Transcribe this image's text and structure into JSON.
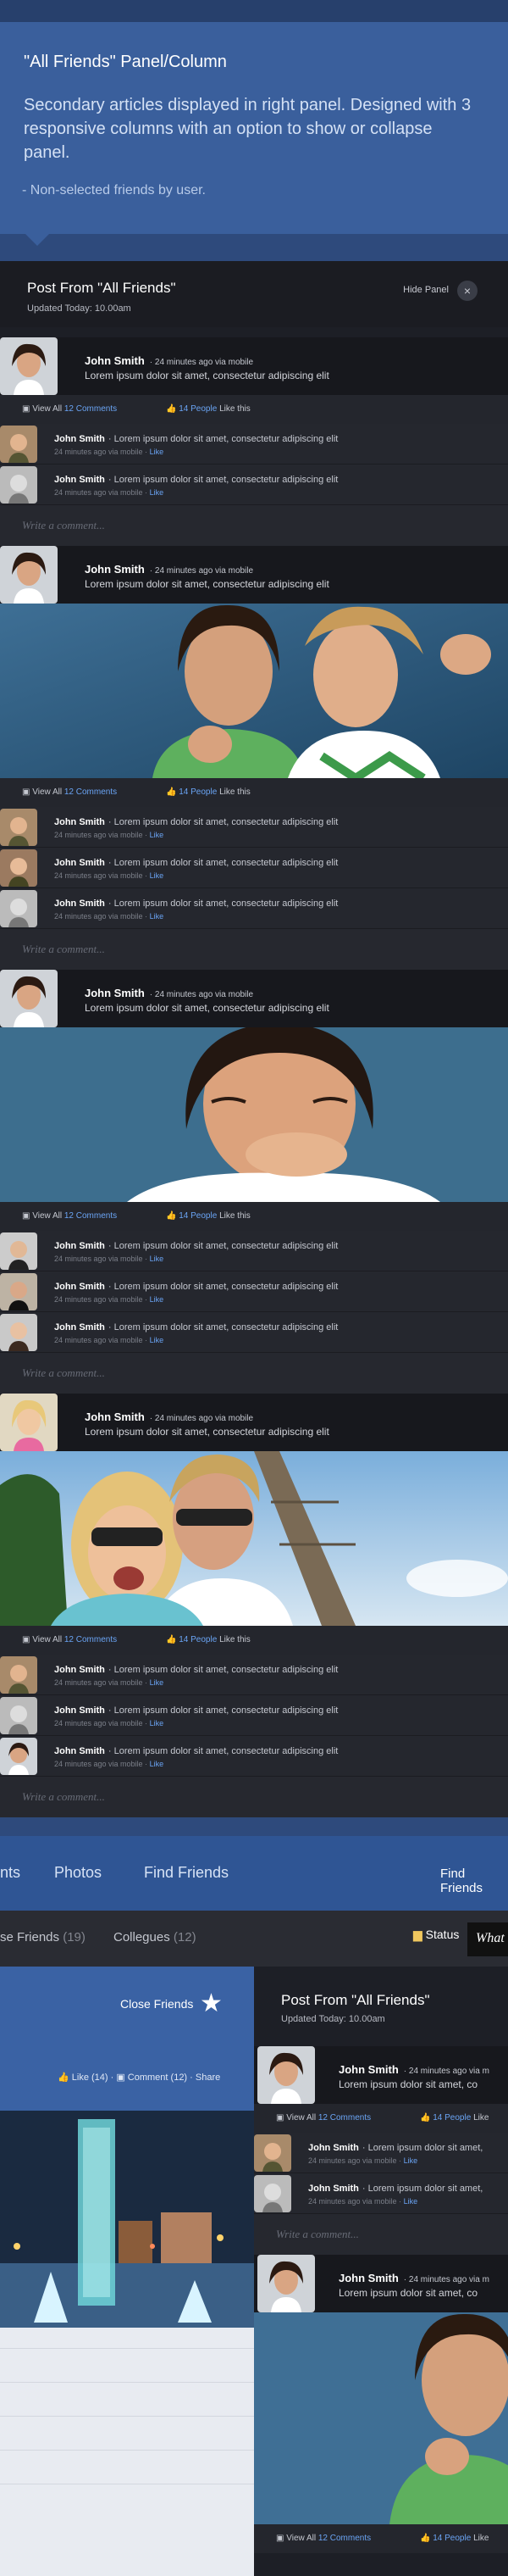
{
  "intro": {
    "title": "\"All Friends\" Panel/Column",
    "description": "Secondary articles displayed in right panel. Designed with 3 responsive columns with an option to show or collapse panel.",
    "note": "- Non-selected friends by user."
  },
  "panel": {
    "title": "Post From \"All Friends\"",
    "updated": "Updated Today: 10.00am",
    "hide_label": "Hide Panel",
    "close_glyph": "×"
  },
  "post": {
    "author": "John Smith",
    "meta": "· 24 minutes ago via mobile",
    "text": "Lorem ipsum dolor sit amet, consectetur adipiscing elit",
    "view_all_prefix": "View All",
    "view_all_count": "12 Comments",
    "likes_count": "14 People",
    "likes_suffix": "Like this"
  },
  "comment": {
    "author": "John Smith",
    "text": "· Lorem ipsum dolor sit amet, consectetur adipiscing elit",
    "time": "24 minutes ago via mobile ·",
    "like": "Like"
  },
  "write_placeholder": "Write a comment...",
  "nav": {
    "items": [
      "nts",
      "Photos",
      "Find Friends"
    ],
    "find_friends_button": "Find Friends"
  },
  "subnav": {
    "close_friends_label": "se Friends",
    "close_friends_count": "(19)",
    "collegues_label": "Collegues",
    "collegues_count": "(12)",
    "status_label": "Status",
    "whats_placeholder": "What"
  },
  "left_card": {
    "close_friends": "Close Friends",
    "like": "Like (14)",
    "comment": "Comment (12)",
    "share": "Share",
    "star_glyph": "★"
  },
  "right_panel": {
    "title": "Post From \"All Friends\"",
    "updated": "Updated Today: 10.00am",
    "author": "John Smith",
    "meta": "· 24 minutes ago via m",
    "text": "Lorem ipsum dolor sit amet, co",
    "view_all": "View All",
    "view_all_count": "12 Comments",
    "likes_count": "14 People",
    "likes_suffix": "Like",
    "comment_author": "John Smith",
    "comment_text": "· Lorem ipsum dolor sit amet,",
    "comment_time": "24 minutes ago via mobile ·",
    "comment_like": "Like",
    "write": "Write a comment..."
  },
  "colors": {
    "brand_blue": "#3a5f9c",
    "panel_bg": "#1d1f26",
    "link_blue": "#6aa4f4"
  }
}
